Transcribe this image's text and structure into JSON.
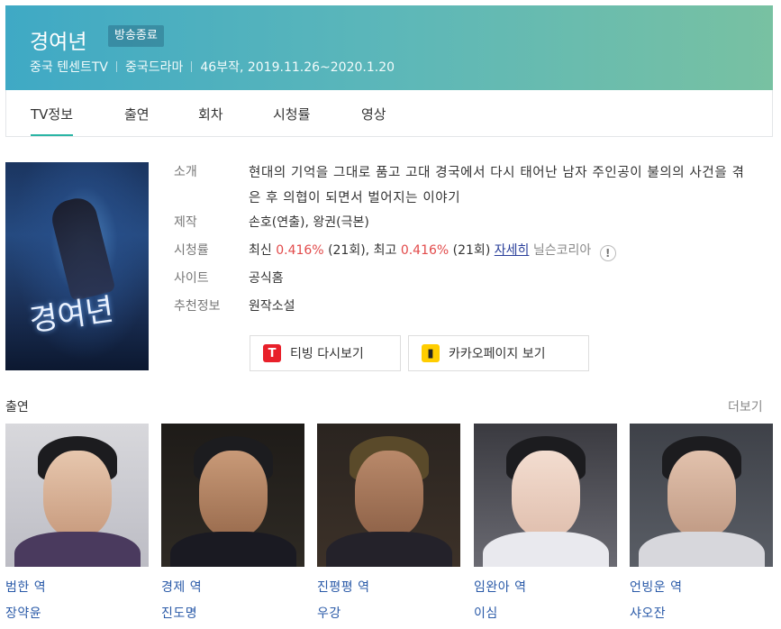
{
  "header": {
    "title": "경여년",
    "badge": "방송종료",
    "network": "중국 텐센트TV",
    "genre": "중국드라마",
    "episodes_dates": "46부작, 2019.11.26~2020.1.20"
  },
  "tabs": [
    {
      "label": "TV정보",
      "active": true
    },
    {
      "label": "출연",
      "active": false
    },
    {
      "label": "회차",
      "active": false
    },
    {
      "label": "시청률",
      "active": false
    },
    {
      "label": "영상",
      "active": false
    }
  ],
  "poster": {
    "title_text": "경여년"
  },
  "info": {
    "intro_label": "소개",
    "intro": "현대의 기억을 그대로 품고 고대 경국에서 다시 태어난 남자 주인공이 불의의 사건을 겪은 후 의협이 되면서 벌어지는 이야기",
    "production_label": "제작",
    "production": "손호(연출), 왕권(극본)",
    "rating_label": "시청률",
    "rating_latest_prefix": "최신",
    "rating_latest_value": "0.416%",
    "rating_latest_episode": "(21회),",
    "rating_best_prefix": "최고",
    "rating_best_value": "0.416%",
    "rating_best_episode": "(21회)",
    "rating_detail_link": "자세히",
    "rating_source": "닐슨코리아",
    "site_label": "사이트",
    "site_link": "공식홈",
    "recommend_label": "추천정보",
    "recommend_link": "원작소설"
  },
  "buttons": {
    "tving": "티빙 다시보기",
    "kakao": "카카오페이지 보기"
  },
  "cast": {
    "title": "출연",
    "more": "더보기",
    "members": [
      {
        "role": "범한 역",
        "actor": "장약윤"
      },
      {
        "role": "경제 역",
        "actor": "진도명"
      },
      {
        "role": "진평평 역",
        "actor": "우강"
      },
      {
        "role": "임완아 역",
        "actor": "이심"
      },
      {
        "role": "언빙운 역",
        "actor": "샤오잔"
      }
    ]
  },
  "colors": {
    "header_gradient_start": "#3fa9c5",
    "header_gradient_end": "#78c1a2",
    "rating_value": "#e24b4b",
    "link": "#2a5aa8",
    "tab_active_underline": "#2bb5a5"
  }
}
